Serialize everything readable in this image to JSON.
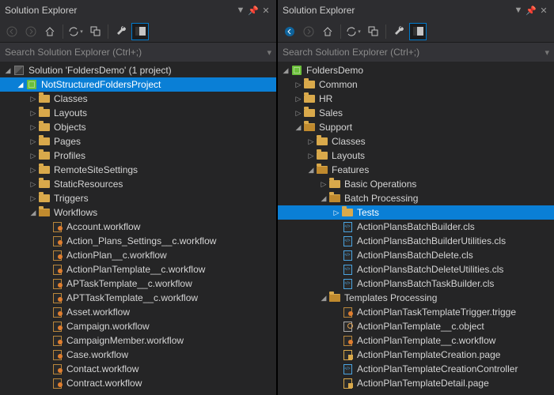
{
  "left": {
    "title": "Solution Explorer",
    "search_placeholder": "Search Solution Explorer (Ctrl+;)",
    "tree": [
      {
        "d": 0,
        "c": "e",
        "i": "sln",
        "t": "Solution 'FoldersDemo' (1 project)",
        "sel": false
      },
      {
        "d": 1,
        "c": "e",
        "i": "prj",
        "t": "NotStructuredFoldersProject",
        "sel": true
      },
      {
        "d": 2,
        "c": "c",
        "i": "fld",
        "t": "Classes"
      },
      {
        "d": 2,
        "c": "c",
        "i": "fld",
        "t": "Layouts"
      },
      {
        "d": 2,
        "c": "c",
        "i": "fld",
        "t": "Objects"
      },
      {
        "d": 2,
        "c": "c",
        "i": "fld",
        "t": "Pages"
      },
      {
        "d": 2,
        "c": "c",
        "i": "fld",
        "t": "Profiles"
      },
      {
        "d": 2,
        "c": "c",
        "i": "fld",
        "t": "RemoteSiteSettings"
      },
      {
        "d": 2,
        "c": "c",
        "i": "fld",
        "t": "StaticResources"
      },
      {
        "d": 2,
        "c": "c",
        "i": "fld",
        "t": "Triggers"
      },
      {
        "d": 2,
        "c": "e",
        "i": "fldo",
        "t": "Workflows"
      },
      {
        "d": 3,
        "c": "",
        "i": "wf",
        "t": "Account.workflow"
      },
      {
        "d": 3,
        "c": "",
        "i": "wf",
        "t": "Action_Plans_Settings__c.workflow"
      },
      {
        "d": 3,
        "c": "",
        "i": "wf",
        "t": "ActionPlan__c.workflow"
      },
      {
        "d": 3,
        "c": "",
        "i": "wf",
        "t": "ActionPlanTemplate__c.workflow"
      },
      {
        "d": 3,
        "c": "",
        "i": "wf",
        "t": "APTaskTemplate__c.workflow"
      },
      {
        "d": 3,
        "c": "",
        "i": "wf",
        "t": "APTTaskTemplate__c.workflow"
      },
      {
        "d": 3,
        "c": "",
        "i": "wf",
        "t": "Asset.workflow"
      },
      {
        "d": 3,
        "c": "",
        "i": "wf",
        "t": "Campaign.workflow"
      },
      {
        "d": 3,
        "c": "",
        "i": "wf",
        "t": "CampaignMember.workflow"
      },
      {
        "d": 3,
        "c": "",
        "i": "wf",
        "t": "Case.workflow"
      },
      {
        "d": 3,
        "c": "",
        "i": "wf",
        "t": "Contact.workflow"
      },
      {
        "d": 3,
        "c": "",
        "i": "wf",
        "t": "Contract.workflow"
      }
    ]
  },
  "right": {
    "title": "Solution Explorer",
    "search_placeholder": "Search Solution Explorer (Ctrl+;)",
    "tree": [
      {
        "d": 0,
        "c": "e",
        "i": "prj",
        "t": "FoldersDemo"
      },
      {
        "d": 1,
        "c": "c",
        "i": "fld",
        "t": "Common"
      },
      {
        "d": 1,
        "c": "c",
        "i": "fld",
        "t": "HR"
      },
      {
        "d": 1,
        "c": "c",
        "i": "fld",
        "t": "Sales"
      },
      {
        "d": 1,
        "c": "e",
        "i": "fldo",
        "t": "Support"
      },
      {
        "d": 2,
        "c": "c",
        "i": "fld",
        "t": "Classes"
      },
      {
        "d": 2,
        "c": "c",
        "i": "fld",
        "t": "Layouts"
      },
      {
        "d": 2,
        "c": "e",
        "i": "fldo",
        "t": "Features"
      },
      {
        "d": 3,
        "c": "c",
        "i": "fld",
        "t": "Basic Operations"
      },
      {
        "d": 3,
        "c": "e",
        "i": "fldo",
        "t": "Batch Processing"
      },
      {
        "d": 4,
        "c": "c",
        "i": "fld",
        "t": "Tests",
        "sel": true
      },
      {
        "d": 4,
        "c": "",
        "i": "cls",
        "t": "ActionPlansBatchBuilder.cls"
      },
      {
        "d": 4,
        "c": "",
        "i": "cls",
        "t": "ActionPlansBatchBuilderUtilities.cls"
      },
      {
        "d": 4,
        "c": "",
        "i": "cls",
        "t": "ActionPlansBatchDelete.cls"
      },
      {
        "d": 4,
        "c": "",
        "i": "cls",
        "t": "ActionPlansBatchDeleteUtilities.cls"
      },
      {
        "d": 4,
        "c": "",
        "i": "cls",
        "t": "ActionPlansBatchTaskBuilder.cls"
      },
      {
        "d": 3,
        "c": "e",
        "i": "fldo",
        "t": "Templates Processing"
      },
      {
        "d": 4,
        "c": "",
        "i": "wf",
        "t": "ActionPlanTaskTemplateTrigger.trigge"
      },
      {
        "d": 4,
        "c": "",
        "i": "obj",
        "t": "ActionPlanTemplate__c.object"
      },
      {
        "d": 4,
        "c": "",
        "i": "wf",
        "t": "ActionPlanTemplate__c.workflow"
      },
      {
        "d": 4,
        "c": "",
        "i": "pg",
        "t": "ActionPlanTemplateCreation.page"
      },
      {
        "d": 4,
        "c": "",
        "i": "cls",
        "t": "ActionPlanTemplateCreationController"
      },
      {
        "d": 4,
        "c": "",
        "i": "pg",
        "t": "ActionPlanTemplateDetail.page"
      }
    ]
  }
}
